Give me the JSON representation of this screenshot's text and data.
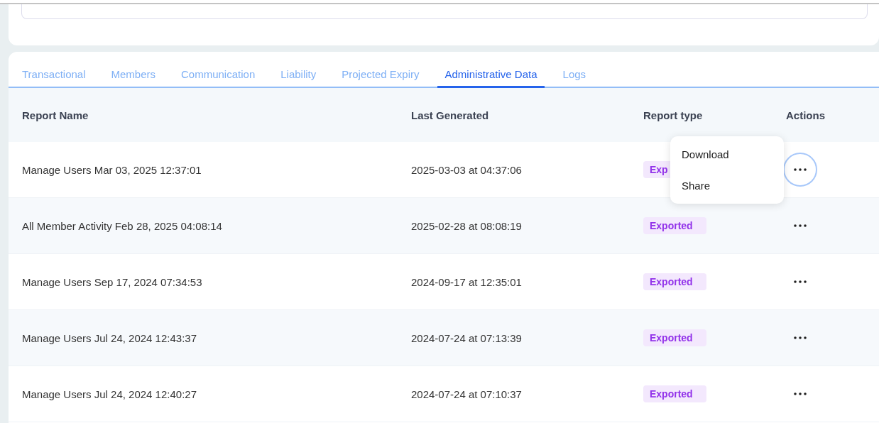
{
  "filter_card": {
    "field": {
      "kind": "input"
    }
  },
  "tabs": [
    {
      "label": "Transactional",
      "selected": false
    },
    {
      "label": "Members",
      "selected": false
    },
    {
      "label": "Communication",
      "selected": false
    },
    {
      "label": "Liability",
      "selected": false
    },
    {
      "label": "Projected Expiry",
      "selected": false
    },
    {
      "label": "Administrative Data",
      "selected": true
    },
    {
      "label": "Logs",
      "selected": false
    }
  ],
  "table": {
    "columns": [
      "Report Name",
      "Last Generated",
      "Report type",
      "Actions"
    ],
    "rows": [
      {
        "name": "Manage Users Mar 03, 2025 12:37:01",
        "generated": "2025-03-03 at 04:37:06",
        "type": "Exp",
        "actions_focused": true
      },
      {
        "name": "All Member Activity Feb 28, 2025 04:08:14",
        "generated": "2025-02-28 at 08:08:19",
        "type": "Exported",
        "actions_focused": false
      },
      {
        "name": "Manage Users Sep 17, 2024 07:34:53",
        "generated": "2024-09-17 at 12:35:01",
        "type": "Exported",
        "actions_focused": false
      },
      {
        "name": "Manage Users Jul 24, 2024 12:43:37",
        "generated": "2024-07-24 at 07:13:39",
        "type": "Exported",
        "actions_focused": false
      },
      {
        "name": "Manage Users Jul 24, 2024 12:40:27",
        "generated": "2024-07-24 at 07:10:37",
        "type": "Exported",
        "actions_focused": false
      }
    ]
  },
  "actions_menu": {
    "items": [
      "Download",
      "Share"
    ]
  }
}
